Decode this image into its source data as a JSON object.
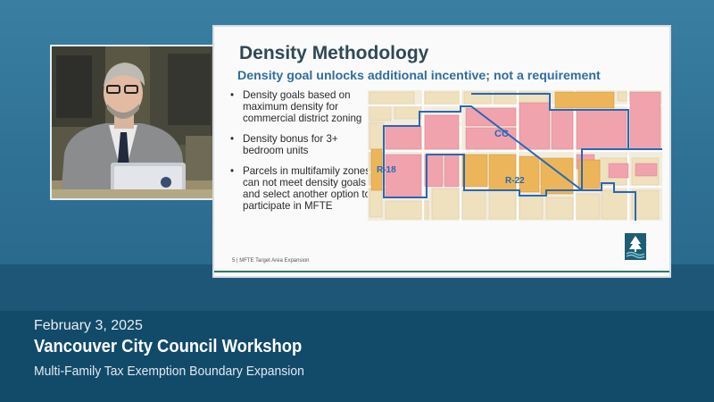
{
  "slide": {
    "title": "Density Methodology",
    "subtitle": "Density goal unlocks additional incentive; not a requirement",
    "bullets": [
      "Density goals based on maximum density for commercial district zoning",
      "Density bonus for 3+ bedroom units",
      "Parcels in multifamily zones can not meet density goals and select another option to participate in MFTE"
    ],
    "map_labels": {
      "cc": "CC",
      "r18": "R-18",
      "r22": "R-22"
    },
    "footer": "5  | MFTE Target Area Expansion",
    "logo_icon": "vancouver-tree-logo-icon"
  },
  "caption": {
    "date": "February 3, 2025",
    "title": "Vancouver City Council Workshop",
    "subtitle": "Multi-Family Tax Exemption Boundary Expansion"
  },
  "colors": {
    "commercial_zone": "#f0a3ad",
    "multifamily_zone": "#edb55a",
    "parcel_neutral": "#efe0be",
    "boundary": "#2868b7",
    "slide_title": "#2f4858",
    "slide_subtitle": "#2d6fa1"
  }
}
